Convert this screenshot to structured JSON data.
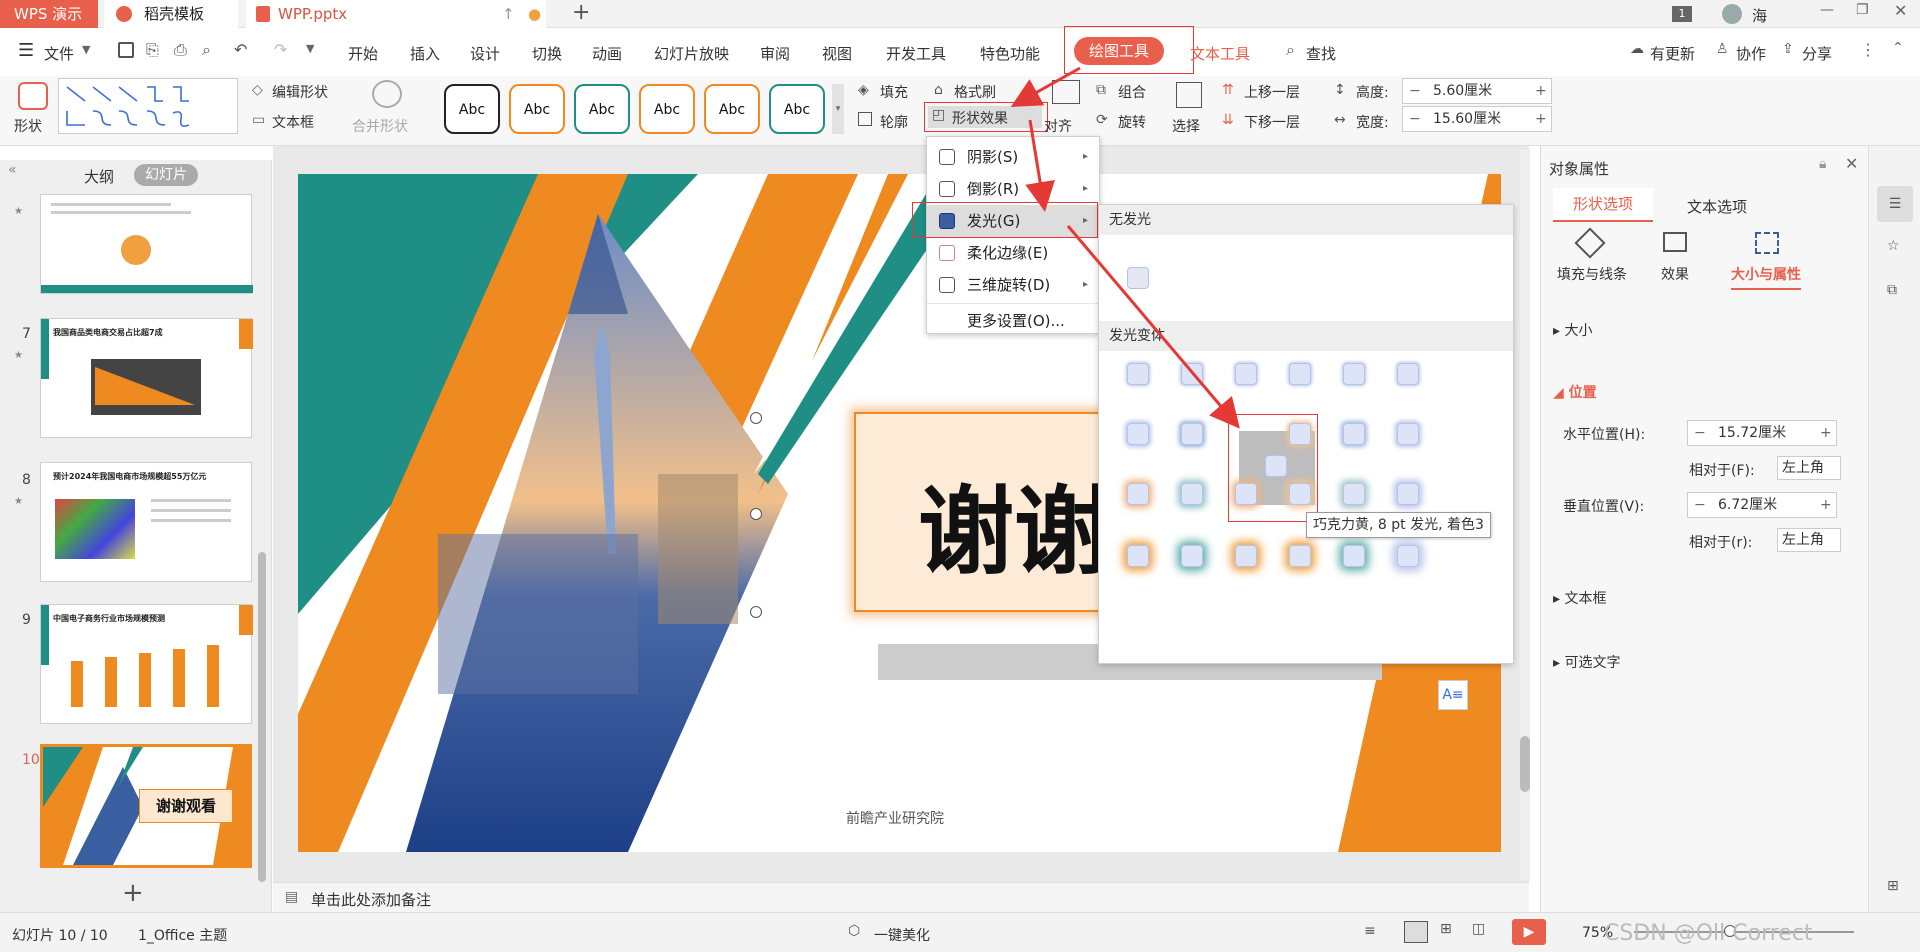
{
  "window": {
    "tabs": [
      "WPS 演示",
      "稻壳模板",
      "WPP.pptx"
    ],
    "badge": "1",
    "user": "海"
  },
  "menubar": {
    "file": "文件",
    "items": [
      "开始",
      "插入",
      "设计",
      "切换",
      "动画",
      "幻灯片放映",
      "审阅",
      "视图",
      "开发工具",
      "特色功能",
      "绘图工具",
      "文本工具"
    ],
    "search": "查找",
    "update": "有更新",
    "collab": "协作",
    "share": "分享"
  },
  "ribbon": {
    "shape": "形状",
    "edit_shape": "编辑形状",
    "textbox": "文本框",
    "merge_shape": "合并形状",
    "style_samples": [
      "Abc",
      "Abc",
      "Abc",
      "Abc",
      "Abc",
      "Abc"
    ],
    "fill": "填充",
    "format_painter": "格式刷",
    "outline": "轮廓",
    "shape_effect": "形状效果",
    "align": "对齐",
    "group": "组合",
    "rotate": "旋转",
    "select": "选择",
    "bring_forward": "上移一层",
    "send_backward": "下移一层",
    "height_label": "高度:",
    "height_value": "5.60厘米",
    "width_label": "宽度:",
    "width_value": "15.60厘米"
  },
  "effect_menu": {
    "items": [
      "阴影(S)",
      "倒影(R)",
      "发光(G)",
      "柔化边缘(E)",
      "三维旋转(D)"
    ],
    "more": "更多设置(O)..."
  },
  "glow_panel": {
    "no_glow": "无发光",
    "variants": "发光变体",
    "tooltip": "巧克力黄, 8 pt 发光, 着色3"
  },
  "left_panel": {
    "tab_outline": "大纲",
    "tab_slides": "幻灯片",
    "slide_numbers": [
      "7",
      "8",
      "9",
      "10"
    ],
    "slide7_title": "我国商品类电商交易占比超7成",
    "slide8_title": "预计2024年我国电商市场规模超55万亿元",
    "slide9_title": "中国电子商务行业市场规模预测",
    "slide10_title": "谢谢观看"
  },
  "slide": {
    "title": "谢谢",
    "footer": "前瞻产业研究院"
  },
  "notes": {
    "placeholder": "单击此处添加备注"
  },
  "right_panel": {
    "title": "对象属性",
    "tab_shape": "形状选项",
    "tab_text": "文本选项",
    "sub_fill": "填充与线条",
    "sub_effect": "效果",
    "sub_size": "大小与属性",
    "sec_size": "大小",
    "sec_position": "位置",
    "h_pos_label": "水平位置(H):",
    "h_pos_value": "15.72厘米",
    "relative_label_f": "相对于(F):",
    "relative_value_1": "左上角",
    "v_pos_label": "垂直位置(V):",
    "v_pos_value": "6.72厘米",
    "relative_label_r": "相对于(r):",
    "relative_value_2": "左上角",
    "sec_textbox": "文本框",
    "sec_alt": "可选文字"
  },
  "status": {
    "slide_counter": "幻灯片 10 / 10",
    "theme": "1_Office 主题",
    "beautify": "一键美化",
    "zoom": "75%"
  },
  "watermark": "CSDN @Oll Correct",
  "colors": {
    "orange": "#ee8a1f",
    "teal": "#1f8f86",
    "accent_red": "#e8604c",
    "highlight_red": "#e53935"
  }
}
